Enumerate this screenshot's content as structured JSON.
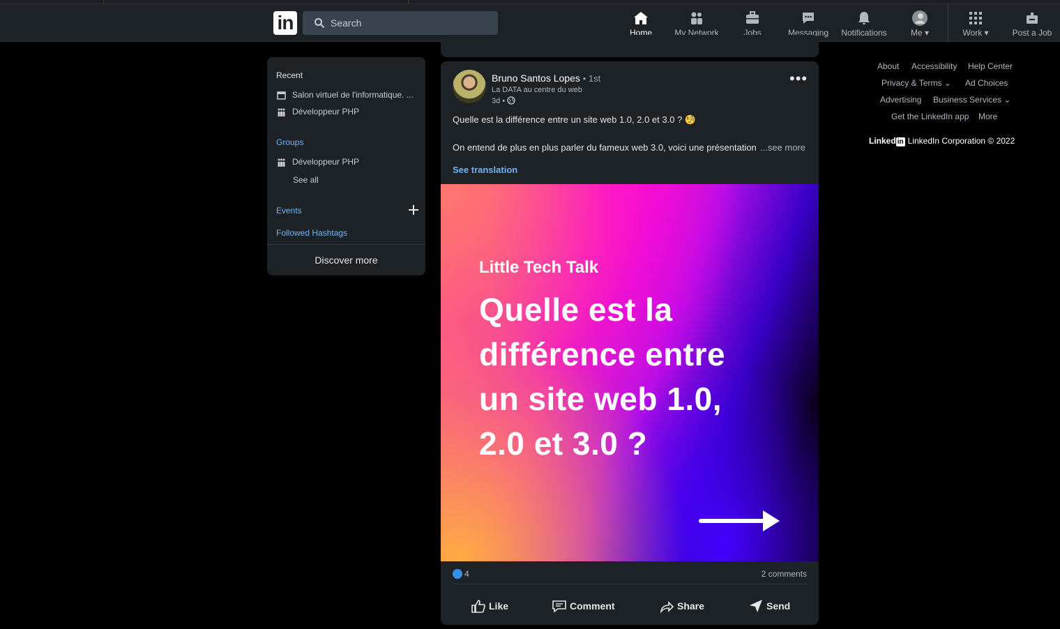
{
  "nav": {
    "logo": "in",
    "search_placeholder": "Search",
    "items": [
      {
        "label": "Home"
      },
      {
        "label": "My Network"
      },
      {
        "label": "Jobs"
      },
      {
        "label": "Messaging"
      },
      {
        "label": "Notifications"
      },
      {
        "label": "Me"
      },
      {
        "label": "Work"
      },
      {
        "label": "Post a Job"
      }
    ]
  },
  "sidebar": {
    "recent_title": "Recent",
    "recent": [
      "Salon virtuel de l'informatique. ...",
      "Développeur PHP"
    ],
    "groups_title": "Groups",
    "groups": [
      "Développeur PHP"
    ],
    "see_all": "See all",
    "events": "Events",
    "hashtags": "Followed Hashtags",
    "discover": "Discover more"
  },
  "post": {
    "author": "Bruno Santos Lopes",
    "degree": "• 1st",
    "headline": "La DATA au centre du web",
    "time": "3d •",
    "text1": "Quelle est la différence entre un site web 1.0, 2.0 et 3.0 ? 🧐",
    "text2": "On entend de plus en plus parler du fameux web 3.0, voici une présentation",
    "see_more": "...see more",
    "see_translation": "See translation",
    "image_kicker": "Little Tech Talk",
    "image_headline": "Quelle est la différence entre un site web 1.0, 2.0 et 3.0 ?",
    "reactions": "4",
    "comments": "2 comments",
    "actions": {
      "like": "Like",
      "comment": "Comment",
      "share": "Share",
      "send": "Send"
    }
  },
  "footer": {
    "links": [
      "About",
      "Accessibility",
      "Help Center",
      "Privacy & Terms",
      "Ad Choices",
      "Advertising",
      "Business Services",
      "Get the LinkedIn app",
      "More"
    ],
    "brand": "Linked",
    "brand_box": "in",
    "copyright": "LinkedIn Corporation © 2022"
  },
  "colors": {
    "accent": "#70b5f9",
    "card": "#1d2226",
    "bg": "#000000"
  }
}
